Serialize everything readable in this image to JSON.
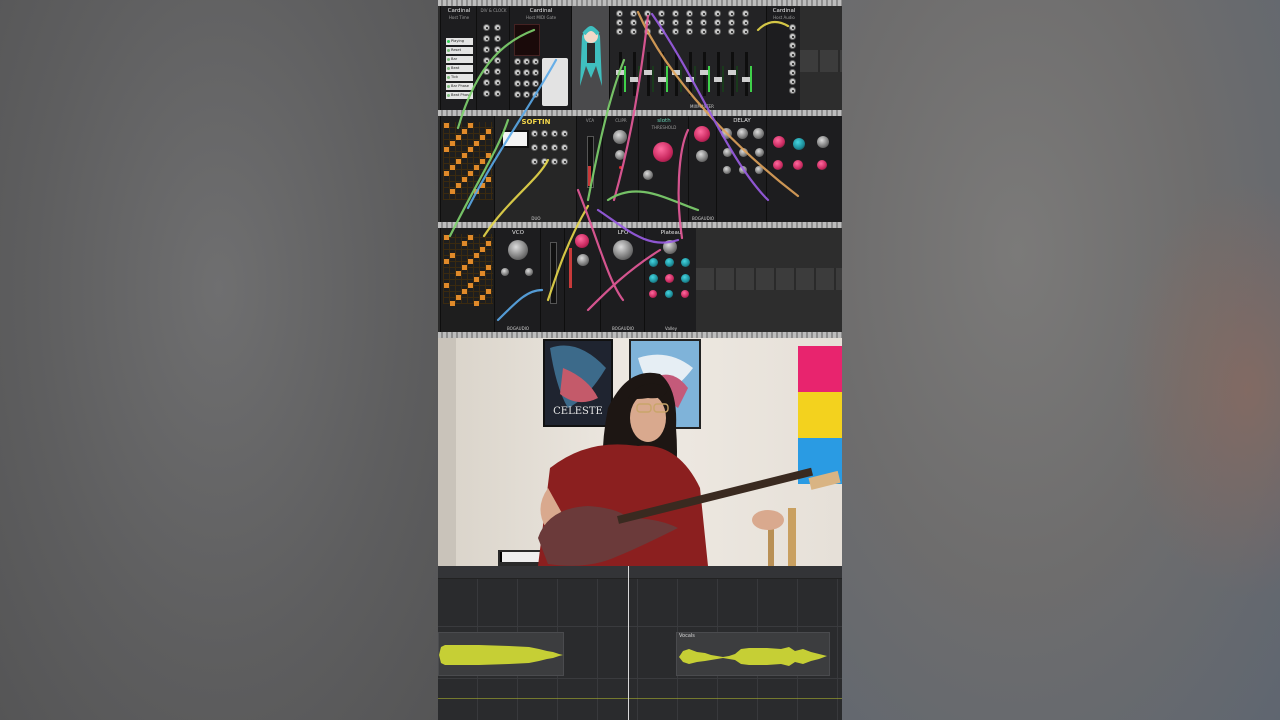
{
  "rack": {
    "row1": {
      "host_time": {
        "brand": "Cardinal",
        "title": "Host Time",
        "items": [
          "Playing",
          "Reset",
          "Bar",
          "Beat",
          "Tick",
          "Bar Phase",
          "Beat Phase"
        ]
      },
      "midi_gate": {
        "brand": "Cardinal",
        "title": "Host MIDI Gate"
      },
      "clock": {
        "title": "DIV & CLOCK"
      },
      "mixer": {
        "brand": "MIXMASTER"
      },
      "host_audio": {
        "brand": "Cardinal",
        "title": "Host Audio"
      }
    },
    "row2": {
      "synth": {
        "title": "SOFTIN",
        "footer": "DUO"
      },
      "clipper": {
        "title": "CLIPR"
      },
      "vca": {
        "title": "VCA"
      },
      "sloth": {
        "title": "sloth",
        "label": "THRESHOLD"
      },
      "delay": {
        "title": "DELAY"
      },
      "bogaudio_label": "BOGAUDIO"
    },
    "row3": {
      "vco": {
        "title": "VCO",
        "footer": "BOGAUDIO"
      },
      "lfo": {
        "title": "LFO",
        "footer": "BOGAUDIO"
      },
      "plateau": {
        "title": "Plateau",
        "footer": "Valley"
      }
    }
  },
  "camera": {
    "poster1_text": "CELESTE"
  },
  "daw": {
    "clip2_label": "Vocals"
  },
  "colors": {
    "cable_green": "#7fd36e",
    "cable_orange": "#e0a35a",
    "cable_purple": "#9b5de5",
    "cable_pink": "#e85a9b",
    "cable_yellow": "#e8d94b",
    "cable_blue": "#5aa9e8",
    "waveform": "#c6cf35"
  }
}
